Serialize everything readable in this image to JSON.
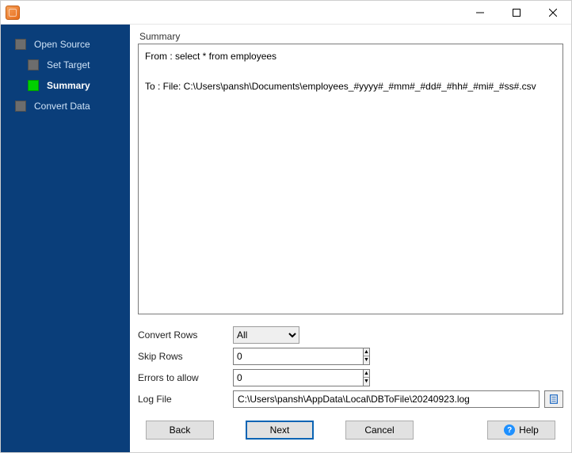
{
  "sidebar": {
    "items": [
      {
        "label": "Open Source",
        "active": false
      },
      {
        "label": "Set Target",
        "active": false
      },
      {
        "label": "Summary",
        "active": true
      },
      {
        "label": "Convert Data",
        "active": false
      }
    ]
  },
  "summary": {
    "header": "Summary",
    "from_line": "From : select * from employees",
    "to_line": "To : File: C:\\Users\\pansh\\Documents\\employees_#yyyy#_#mm#_#dd#_#hh#_#mi#_#ss#.csv"
  },
  "form": {
    "convert_rows_label": "Convert Rows",
    "convert_rows_value": "All",
    "skip_rows_label": "Skip Rows",
    "skip_rows_value": "0",
    "errors_label": "Errors to allow",
    "errors_value": "0",
    "log_label": "Log File",
    "log_value": "C:\\Users\\pansh\\AppData\\Local\\DBToFile\\20240923.log"
  },
  "buttons": {
    "back": "Back",
    "next": "Next",
    "cancel": "Cancel",
    "help": "Help"
  }
}
